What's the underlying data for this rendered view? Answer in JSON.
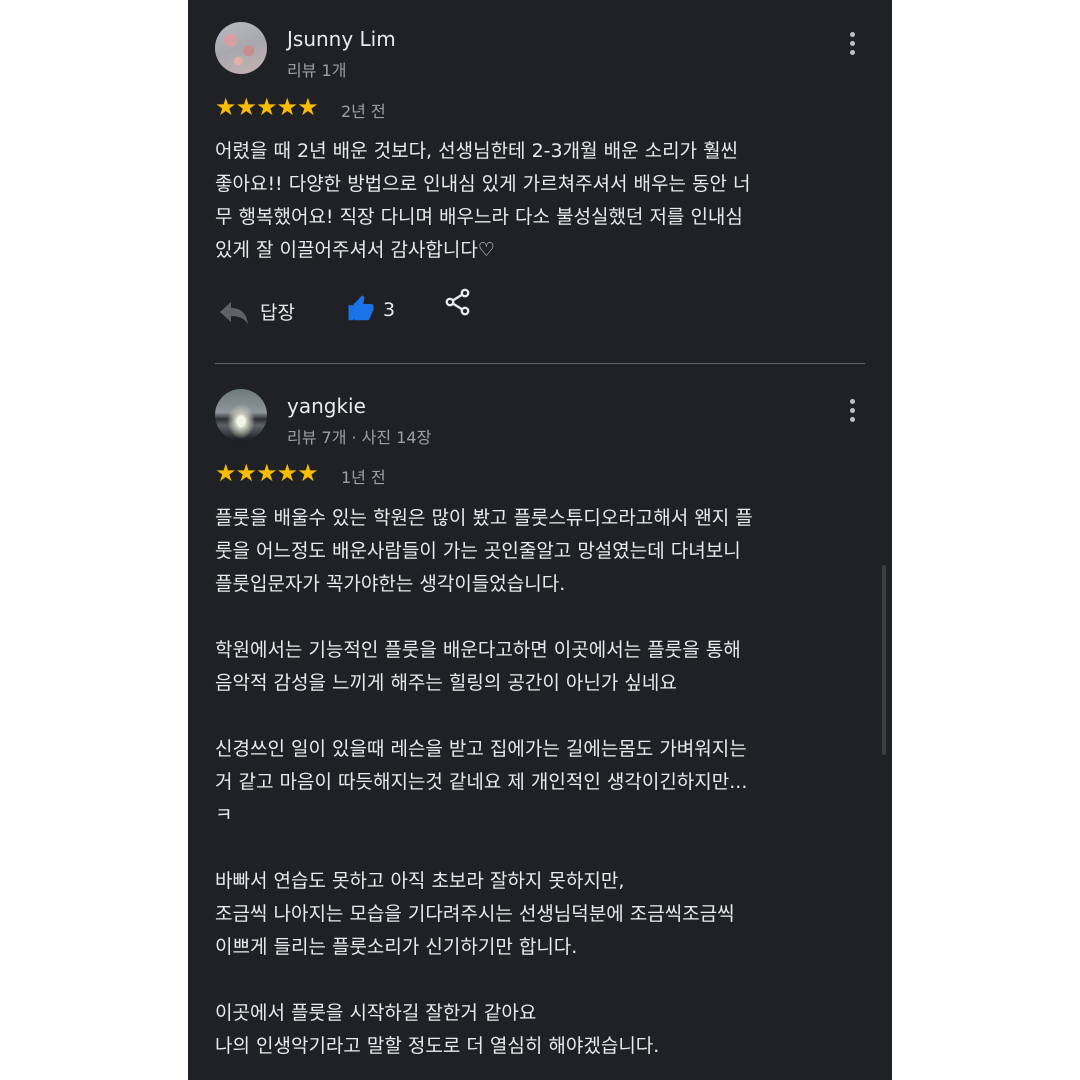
{
  "reviews": [
    {
      "author": "Jsunny Lim",
      "meta": "리뷰 1개",
      "rating": 5,
      "stars": "★★★★★",
      "time_ago": "2년 전",
      "text": "어렸을 때 2년 배운 것보다, 선생님한테 2-3개월 배운 소리가 훨씬\n좋아요!! 다양한 방법으로 인내심 있게 가르쳐주셔서 배우는 동안 너\n무 행복했어요! 직장 다니며 배우느라 다소 불성실했던 저를 인내심\n있게 잘 이끌어주셔서 감사합니다♡",
      "reply_label": "답장",
      "like_count": "3"
    },
    {
      "author": "yangkie",
      "meta": "리뷰 7개 · 사진 14장",
      "rating": 5,
      "stars": "★★★★★",
      "time_ago": "1년 전",
      "text": "플룻을 배울수 있는 학원은 많이 봤고 플룻스튜디오라고해서 왠지 플\n룻을 어느정도 배운사람들이 가는 곳인줄알고 망설였는데 다녀보니\n플룻입문자가 꼭가야한는 생각이들었습니다.\n\n학원에서는 기능적인 플룻을 배운다고하면 이곳에서는 플룻을 통해\n음악적 감성을 느끼게 해주는 힐링의 공간이 아닌가 싶네요\n\n신경쓰인 일이 있을때 레슨을 받고 집에가는 길에는몸도 가벼워지는\n거 같고 마음이 따듯해지는것 같네요 제 개인적인 생각이긴하지만...\nㅋ\n\n바빠서 연습도 못하고 아직 초보라 잘하지 못하지만,\n조금씩 나아지는 모습을 기다려주시는 선생님덕분에 조금씩조금씩\n이쁘게 들리는 플룻소리가 신기하기만 합니다.\n\n이곳에서 플룻을 시작하길 잘한거 같아요\n나의 인생악기라고 말할 정도로 더 열심히 해야겠습니다."
    }
  ],
  "colors": {
    "background": "#202124",
    "star": "#fbbc04",
    "like_active": "#1a73e8",
    "text_primary": "#e8eaed",
    "text_secondary": "#9aa0a6"
  },
  "icons": {
    "reply": "reply-arrow-icon",
    "like": "thumbs-up-icon",
    "share": "share-icon",
    "more": "more-vert-icon"
  }
}
